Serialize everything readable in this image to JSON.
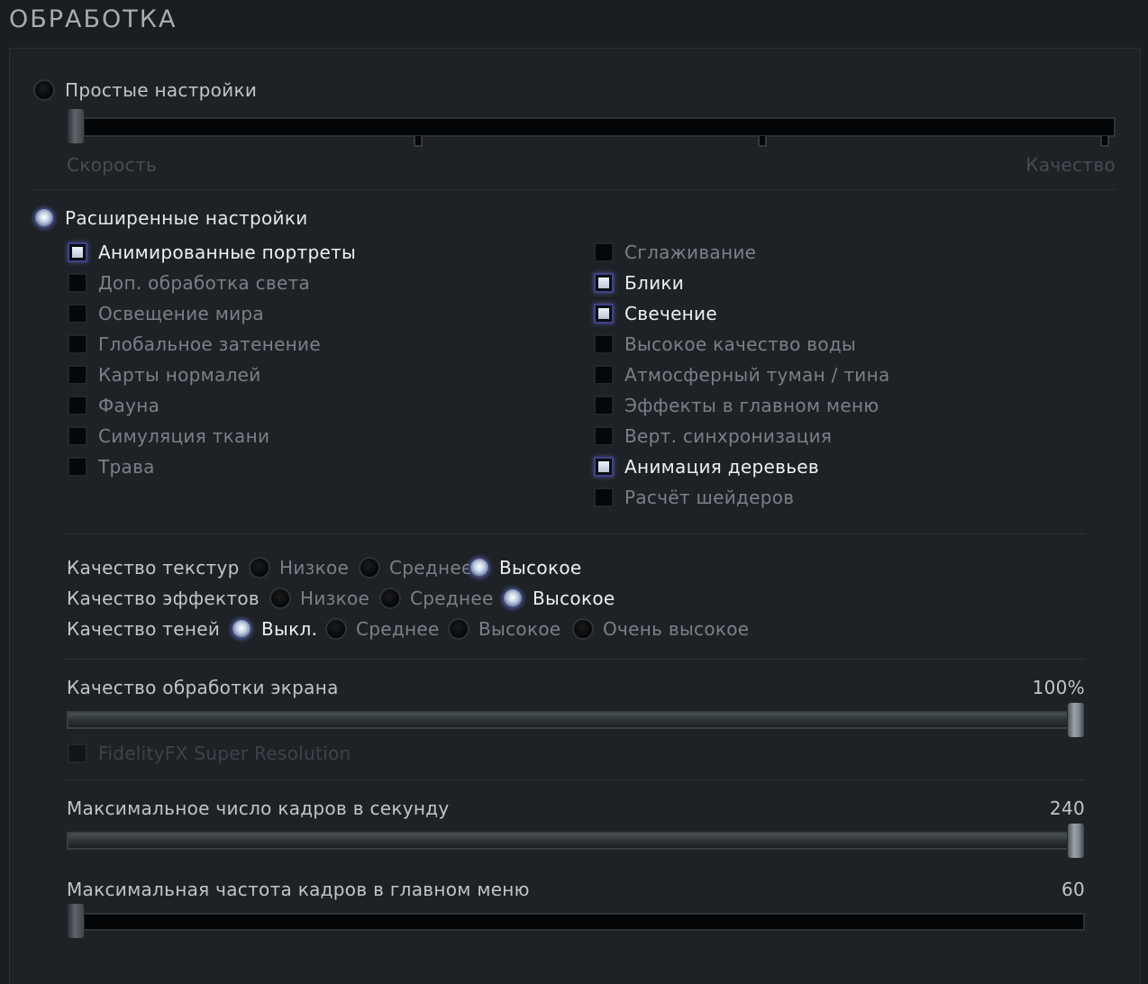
{
  "title": "ОБРАБОТКА",
  "simple": {
    "label": "Простые настройки",
    "left_label": "Скорость",
    "right_label": "Качество",
    "slider_position": 0,
    "slider_steps": 4
  },
  "advanced": {
    "label": "Расширенные настройки",
    "selected": true,
    "left_checkboxes": [
      {
        "label": "Анимированные портреты",
        "checked": true
      },
      {
        "label": "Доп. обработка света",
        "checked": false
      },
      {
        "label": "Освещение мира",
        "checked": false
      },
      {
        "label": "Глобальное затенение",
        "checked": false
      },
      {
        "label": "Карты нормалей",
        "checked": false
      },
      {
        "label": "Фауна",
        "checked": false
      },
      {
        "label": "Симуляция ткани",
        "checked": false
      },
      {
        "label": "Трава",
        "checked": false
      }
    ],
    "right_checkboxes": [
      {
        "label": "Сглаживание",
        "checked": false
      },
      {
        "label": "Блики",
        "checked": true
      },
      {
        "label": "Свечение",
        "checked": true
      },
      {
        "label": "Высокое качество воды",
        "checked": false
      },
      {
        "label": "Атмосферный туман / тина",
        "checked": false
      },
      {
        "label": "Эффекты в главном меню",
        "checked": false
      },
      {
        "label": "Верт. синхронизация",
        "checked": false
      },
      {
        "label": "Анимация деревьев",
        "checked": true
      },
      {
        "label": "Расчёт шейдеров",
        "checked": false
      }
    ]
  },
  "quality": {
    "texture": {
      "label": "Качество текстур",
      "options": [
        "Низкое",
        "Среднее",
        "Высокое"
      ],
      "selected": 2
    },
    "effects": {
      "label": "Качество эффектов",
      "options": [
        "Низкое",
        "Среднее",
        "Высокое"
      ],
      "selected": 2
    },
    "shadows": {
      "label": "Качество теней",
      "options": [
        "Выкл.",
        "Среднее",
        "Высокое",
        "Очень высокое"
      ],
      "selected": 0
    }
  },
  "screen_quality": {
    "label": "Качество обработки экрана",
    "value_text": "100%",
    "fraction": 1.0
  },
  "fsr": {
    "label": "FidelityFX Super Resolution",
    "checked": false,
    "disabled": true
  },
  "max_fps": {
    "label": "Максимальное число кадров в секунду",
    "value_text": "240",
    "fraction": 1.0
  },
  "menu_fps": {
    "label": "Максимальная частота кадров в главном меню",
    "value_text": "60",
    "fraction": 0.0
  },
  "colors": {
    "accent": "#3e4388",
    "text_on": "#ecf0f3",
    "text_dim": "#7a8087",
    "background": "#1e2226"
  }
}
